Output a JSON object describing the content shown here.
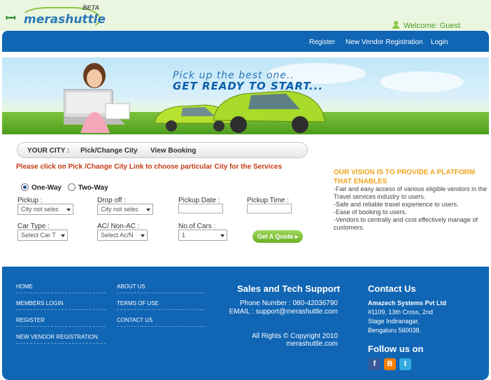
{
  "brand": {
    "logo_word": "merashuttle",
    "beta": "BETA"
  },
  "header": {
    "welcome": "Welcome: Guest"
  },
  "nav": {
    "register": "Register",
    "vendor": "New Vendor Registration",
    "login": "Login"
  },
  "banner": {
    "tagline_1": "Pick up the best one..",
    "tagline_2": "GET READY TO START..."
  },
  "city_tabs": {
    "your_city": "YOUR CITY :",
    "pick_change": "Pick/Change City",
    "view_booking": "View Booking"
  },
  "notice": "Please click on Pick /Change City Link to choose particular City for the Services",
  "trip": {
    "one_way": "One-Way",
    "two_way": "Two-Way",
    "selected": "one-way"
  },
  "form": {
    "pickup_label": "Pickup :",
    "pickup_value": "City not selec",
    "dropoff_label": "Drop off :",
    "dropoff_value": "City not selec",
    "pickup_date_label": "Pickup Date :",
    "pickup_time_label": "Pickup Time :",
    "car_type_label": "Car Type :",
    "car_type_value": "Select Car T",
    "ac_label": "AC/ Non-AC :",
    "ac_value": "Select Ac/N",
    "cars_label": "No.of Cars :",
    "cars_value": "1",
    "quote_button": "Get A Quote"
  },
  "vision": {
    "title": "OUR VISION IS TO PROVIDE A PLATFORM THAT ENABLES",
    "points": [
      "-Fair and easy access of various eligible vendors in the Travel services industry to users.",
      "-Safe and reliable travel experience to users.",
      "-Ease of booking to users.",
      "-Vendors to centrally and cost effectively manage of customers."
    ]
  },
  "footer": {
    "links_left": [
      "HOME",
      "MEMBERS LOGIN",
      "REGISTER",
      "NEW VENDOR REGISTRATION"
    ],
    "links_right": [
      "ABOUT US",
      "TERMS OF USE",
      "CONTACT US"
    ],
    "support_title": "Sales and Tech Support",
    "phone": "Phone Number : 080-42036790",
    "email": "EMAIL : support@merashuttle.com",
    "copyright": "All Rights © Copyright 2010",
    "site": "merashuttle.com",
    "contact_title": "Contact Us",
    "company": "Amazech Systems Pvt Ltd",
    "address_1": "#1109, 13th Cross, 2nd",
    "address_2": "Stage Indiranagar,",
    "address_3": "Bengaluru 560038.",
    "follow_title": "Follow us on",
    "social": [
      "facebook-icon",
      "blogger-icon",
      "twitter-icon"
    ]
  },
  "colors": {
    "nav_blue": "#1065b4",
    "accent_green": "#8cc63f",
    "notice_red": "#c53a13",
    "vision_orange": "#f0a31c"
  }
}
